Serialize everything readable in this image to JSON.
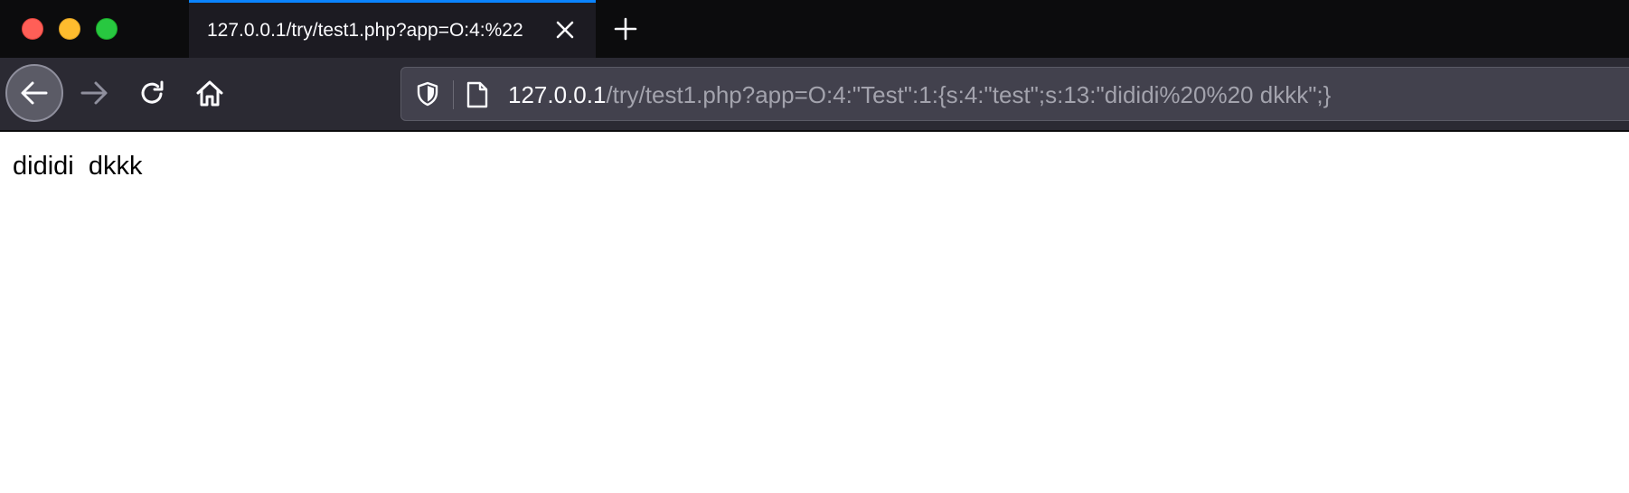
{
  "window": {
    "controls": [
      "close",
      "minimize",
      "zoom"
    ]
  },
  "tab": {
    "title": "127.0.0.1/try/test1.php?app=O:4:%22",
    "close_icon": "close-icon",
    "accent_color": "#0a84ff"
  },
  "tabbar": {
    "new_tab_icon": "plus-icon"
  },
  "toolbar": {
    "back_icon": "arrow-left-icon",
    "forward_icon": "arrow-right-icon",
    "reload_icon": "reload-icon",
    "home_icon": "home-icon"
  },
  "urlbar": {
    "host": "127.0.0.1",
    "path": "/try/test1.php?app=O:4:\"Test\":1:{s:4:\"test\";s:13:\"dididi%20%20 dkkk\";}",
    "shield_icon": "tracking-protection-shield-icon",
    "page_icon": "page-document-icon"
  },
  "page": {
    "text": "dididi  dkkk"
  }
}
